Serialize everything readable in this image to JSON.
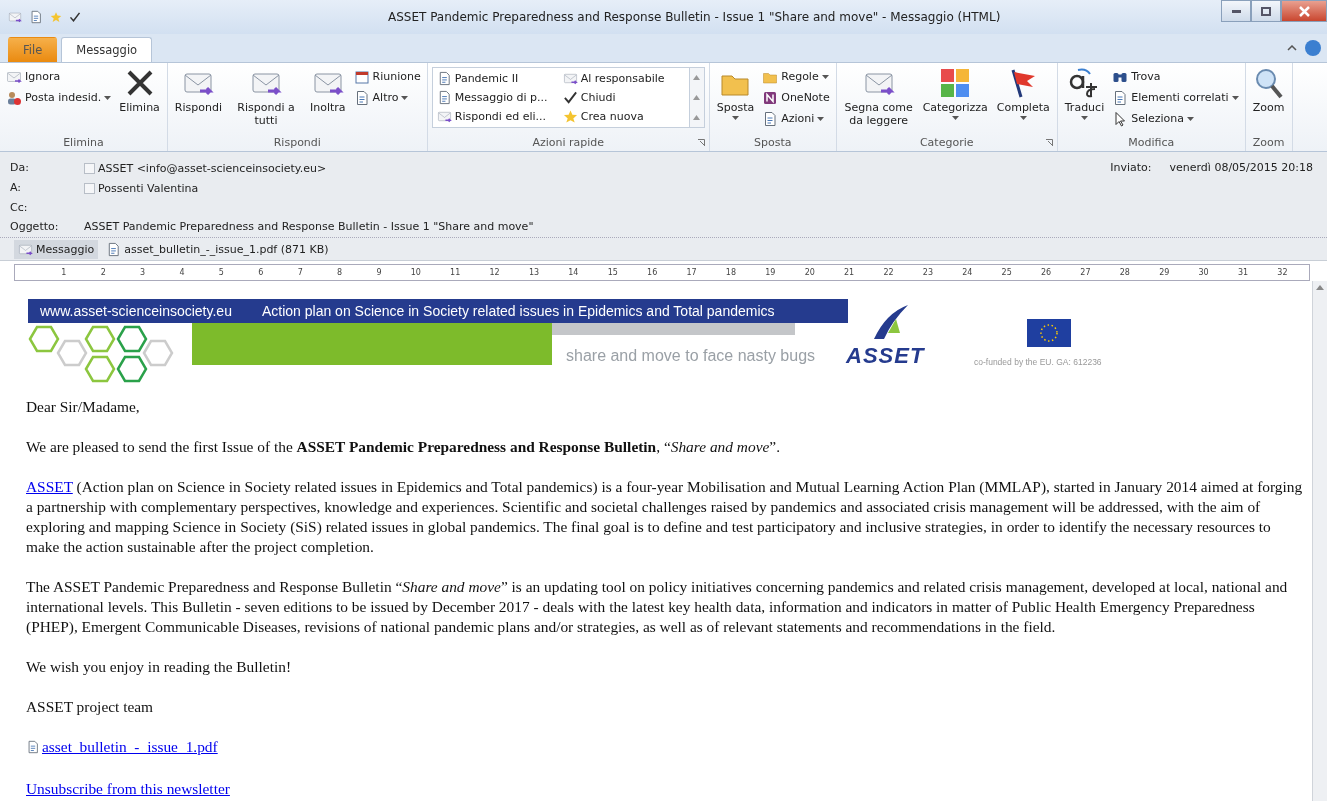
{
  "window": {
    "title": "ASSET Pandemic Preparedness and Response Bulletin - Issue 1 \"Share and move\"  -  Messaggio (HTML)"
  },
  "tabs": [
    {
      "label": "File",
      "kind": "file",
      "selected": false
    },
    {
      "label": "Messaggio",
      "kind": "tab",
      "selected": true
    }
  ],
  "ribbon": [
    {
      "label": "Elimina",
      "launcher": false,
      "columns": [
        {
          "kind": "stack",
          "items": [
            {
              "label": "Ignora",
              "dropdown": false
            },
            {
              "label": "Posta indesid.",
              "dropdown": true
            }
          ]
        },
        {
          "kind": "large",
          "label": "Elimina",
          "dropdown": false
        }
      ]
    },
    {
      "label": "Rispondi",
      "launcher": false,
      "columns": [
        {
          "kind": "large",
          "label": "Rispondi",
          "dropdown": false
        },
        {
          "kind": "large",
          "label": "Rispondi a tutti",
          "dropdown": false
        },
        {
          "kind": "large",
          "label": "Inoltra",
          "dropdown": false
        },
        {
          "kind": "stack",
          "items": [
            {
              "label": "Riunione",
              "dropdown": false
            },
            {
              "label": "Altro",
              "dropdown": true
            }
          ]
        }
      ]
    },
    {
      "label": "Azioni rapide",
      "launcher": true,
      "columns": [
        {
          "kind": "gallery",
          "items": [
            {
              "label": "Pandemic II"
            },
            {
              "label": "Al responsabile"
            },
            {
              "label": "Messaggio di p..."
            },
            {
              "label": "Chiudi"
            },
            {
              "label": "Rispondi ed eli..."
            },
            {
              "label": "Crea nuova"
            }
          ]
        }
      ]
    },
    {
      "label": "Sposta",
      "launcher": false,
      "columns": [
        {
          "kind": "large",
          "label": "Sposta",
          "dropdown": true
        },
        {
          "kind": "stack",
          "items": [
            {
              "label": "Regole",
              "dropdown": true
            },
            {
              "label": "OneNote",
              "dropdown": false
            },
            {
              "label": "Azioni",
              "dropdown": true
            }
          ]
        }
      ]
    },
    {
      "label": "Categorie",
      "launcher": true,
      "columns": [
        {
          "kind": "large",
          "label": "Segna come da leggere",
          "dropdown": false
        },
        {
          "kind": "large",
          "label": "Categorizza",
          "dropdown": true
        },
        {
          "kind": "large",
          "label": "Completa",
          "dropdown": true
        }
      ]
    },
    {
      "label": "Modifica",
      "launcher": false,
      "columns": [
        {
          "kind": "large",
          "label": "Traduci",
          "dropdown": true
        },
        {
          "kind": "stack",
          "items": [
            {
              "label": "Trova",
              "dropdown": false
            },
            {
              "label": "Elementi correlati",
              "dropdown": true
            },
            {
              "label": "Seleziona",
              "dropdown": true
            }
          ]
        }
      ]
    },
    {
      "label": "Zoom",
      "launcher": false,
      "columns": [
        {
          "kind": "large",
          "label": "Zoom",
          "dropdown": false
        }
      ]
    }
  ],
  "header": {
    "from_checked": false,
    "to_checked": false,
    "from_label": "Da:",
    "from": "ASSET <info@asset-scienceinsociety.eu>",
    "to_label": "A:",
    "to": "Possenti Valentina",
    "cc_label": "Cc:",
    "subject_label": "Oggetto:",
    "subject": "ASSET Pandemic Preparedness and Response Bulletin - Issue 1 \"Share and move\"",
    "sent_label": "Inviato:",
    "sent": "venerdì 08/05/2015 20:18"
  },
  "attachments": [
    {
      "label": "Messaggio",
      "kind": "message",
      "selected": true
    },
    {
      "label": "asset_bulletin_-_issue_1.pdf (871 KB)",
      "kind": "pdf",
      "selected": false
    }
  ],
  "ruler": [
    "1",
    "2",
    "3",
    "4",
    "5",
    "6",
    "7",
    "8",
    "9",
    "10",
    "11",
    "12",
    "13",
    "14",
    "15",
    "16",
    "17",
    "18",
    "19",
    "20",
    "21",
    "22",
    "23",
    "24",
    "25",
    "26",
    "27",
    "28",
    "29",
    "30",
    "31",
    "32"
  ],
  "banner": {
    "url": "www.asset-scienceinsociety.eu",
    "tagline": "Action plan on Science in Society related issues in Epidemics and Total pandemics",
    "slogan": "share and move to face nasty bugs",
    "logo": "ASSET",
    "funding": "co-funded by the EU. GA: 612236"
  },
  "body": [
    {
      "kind": "text",
      "text": "Dear Sir/Madame,"
    },
    {
      "kind": "text",
      "text": "We are pleased to send the first Issue of the **ASSET Pandemic Preparedness and Response Bulletin**, “*Share and move*”."
    },
    {
      "kind": "lead_link",
      "link": "ASSET",
      "text": " (Action plan on Science in Society related issues in Epidemics and Total pandemics) is a four-year Mobilisation and Mutual Learning Action Plan (MMLAP), started in January 2014 aimed at forging a partnership with complementary perspectives, knowledge and experiences. Scientific and societal challenges raised by pandemics and associated crisis management will be addressed, with the aim of exploring and mapping Science in Society (SiS) related issues in global pandemics. The final goal is to define and test participatory and inclusive strategies, in order to identify the necessary resources to make the action sustainable after the project completion."
    },
    {
      "kind": "text",
      "text": "The ASSET Pandemic Preparedness and Response Bulletin “*Share and move*” is an updating tool on policy initiatives concerning pandemics and related crisis management, developed at local, national and international levels. This Bulletin - seven editions to be issued by December 2017 - deals with the latest key health data, information and indicators in matter of Public Health Emergency Preparedness (PHEP), Emergent Communicable Diseases, revisions of national pandemic plans and/or strategies, as well as of relevant statements and recommendations in the field."
    },
    {
      "kind": "text",
      "text": "We wish you enjoy in reading the Bulletin!"
    },
    {
      "kind": "text",
      "text": "ASSET project team"
    },
    {
      "kind": "file_link",
      "text": "asset_bulletin_-_issue_1.pdf"
    },
    {
      "kind": "link",
      "text": "Unsubscribe from this newsletter"
    }
  ]
}
